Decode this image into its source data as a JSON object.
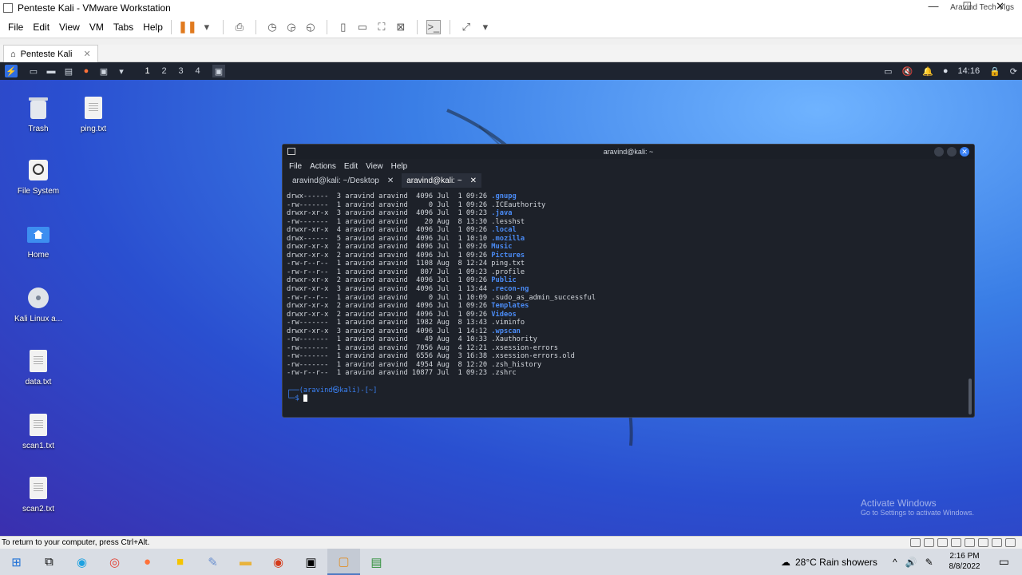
{
  "vmware": {
    "title": "Penteste Kali - VMware Workstation",
    "watermark": "Aravind Tech Vlgs",
    "menu": [
      "File",
      "Edit",
      "View",
      "VM",
      "Tabs",
      "Help"
    ],
    "tab": "Penteste Kali",
    "status": "To return to your computer, press Ctrl+Alt."
  },
  "guest_bar": {
    "workspaces": [
      "1",
      "2",
      "3",
      "4"
    ],
    "time": "14:16"
  },
  "desktop": {
    "icons": [
      {
        "label": "Trash",
        "icon": "trash-icon"
      },
      {
        "label": "ping.txt",
        "icon": "text-file-icon"
      },
      {
        "label": "File System",
        "icon": "drive-icon"
      },
      {
        "label": "Home",
        "icon": "home-folder-icon"
      },
      {
        "label": "Kali Linux a...",
        "icon": "disc-icon"
      },
      {
        "label": "data.txt",
        "icon": "text-file-icon"
      },
      {
        "label": "scan1.txt",
        "icon": "text-file-icon"
      },
      {
        "label": "scan2.txt",
        "icon": "text-file-icon"
      }
    ],
    "activate_line1": "Activate Windows",
    "activate_line2": "Go to Settings to activate Windows."
  },
  "terminal": {
    "title": "aravind@kali: ~",
    "menu": [
      "File",
      "Actions",
      "Edit",
      "View",
      "Help"
    ],
    "tabs": [
      "aravind@kali: ~/Desktop",
      "aravind@kali: ~"
    ],
    "listing": [
      {
        "perm": "drwx------",
        "links": "3",
        "user": "aravind",
        "group": "aravind",
        "size": "4096",
        "month": "Jul",
        "day": "1",
        "time": "09:26",
        "name": ".gnupg",
        "dir": true
      },
      {
        "perm": "-rw-------",
        "links": "1",
        "user": "aravind",
        "group": "aravind",
        "size": "0",
        "month": "Jul",
        "day": "1",
        "time": "09:26",
        "name": ".ICEauthority",
        "dir": false
      },
      {
        "perm": "drwxr-xr-x",
        "links": "3",
        "user": "aravind",
        "group": "aravind",
        "size": "4096",
        "month": "Jul",
        "day": "1",
        "time": "09:23",
        "name": ".java",
        "dir": true
      },
      {
        "perm": "-rw-------",
        "links": "1",
        "user": "aravind",
        "group": "aravind",
        "size": "20",
        "month": "Aug",
        "day": "8",
        "time": "13:30",
        "name": ".lesshst",
        "dir": false
      },
      {
        "perm": "drwxr-xr-x",
        "links": "4",
        "user": "aravind",
        "group": "aravind",
        "size": "4096",
        "month": "Jul",
        "day": "1",
        "time": "09:26",
        "name": ".local",
        "dir": true
      },
      {
        "perm": "drwx------",
        "links": "5",
        "user": "aravind",
        "group": "aravind",
        "size": "4096",
        "month": "Jul",
        "day": "1",
        "time": "10:10",
        "name": ".mozilla",
        "dir": true
      },
      {
        "perm": "drwxr-xr-x",
        "links": "2",
        "user": "aravind",
        "group": "aravind",
        "size": "4096",
        "month": "Jul",
        "day": "1",
        "time": "09:26",
        "name": "Music",
        "dir": true
      },
      {
        "perm": "drwxr-xr-x",
        "links": "2",
        "user": "aravind",
        "group": "aravind",
        "size": "4096",
        "month": "Jul",
        "day": "1",
        "time": "09:26",
        "name": "Pictures",
        "dir": true
      },
      {
        "perm": "-rw-r--r--",
        "links": "1",
        "user": "aravind",
        "group": "aravind",
        "size": "1108",
        "month": "Aug",
        "day": "8",
        "time": "12:24",
        "name": "ping.txt",
        "dir": false
      },
      {
        "perm": "-rw-r--r--",
        "links": "1",
        "user": "aravind",
        "group": "aravind",
        "size": "807",
        "month": "Jul",
        "day": "1",
        "time": "09:23",
        "name": ".profile",
        "dir": false
      },
      {
        "perm": "drwxr-xr-x",
        "links": "2",
        "user": "aravind",
        "group": "aravind",
        "size": "4096",
        "month": "Jul",
        "day": "1",
        "time": "09:26",
        "name": "Public",
        "dir": true
      },
      {
        "perm": "drwxr-xr-x",
        "links": "3",
        "user": "aravind",
        "group": "aravind",
        "size": "4096",
        "month": "Jul",
        "day": "1",
        "time": "13:44",
        "name": ".recon-ng",
        "dir": true
      },
      {
        "perm": "-rw-r--r--",
        "links": "1",
        "user": "aravind",
        "group": "aravind",
        "size": "0",
        "month": "Jul",
        "day": "1",
        "time": "10:09",
        "name": ".sudo_as_admin_successful",
        "dir": false
      },
      {
        "perm": "drwxr-xr-x",
        "links": "2",
        "user": "aravind",
        "group": "aravind",
        "size": "4096",
        "month": "Jul",
        "day": "1",
        "time": "09:26",
        "name": "Templates",
        "dir": true
      },
      {
        "perm": "drwxr-xr-x",
        "links": "2",
        "user": "aravind",
        "group": "aravind",
        "size": "4096",
        "month": "Jul",
        "day": "1",
        "time": "09:26",
        "name": "Videos",
        "dir": true
      },
      {
        "perm": "-rw-------",
        "links": "1",
        "user": "aravind",
        "group": "aravind",
        "size": "1982",
        "month": "Aug",
        "day": "8",
        "time": "13:43",
        "name": ".viminfo",
        "dir": false
      },
      {
        "perm": "drwxr-xr-x",
        "links": "3",
        "user": "aravind",
        "group": "aravind",
        "size": "4096",
        "month": "Jul",
        "day": "1",
        "time": "14:12",
        "name": ".wpscan",
        "dir": true
      },
      {
        "perm": "-rw-------",
        "links": "1",
        "user": "aravind",
        "group": "aravind",
        "size": "49",
        "month": "Aug",
        "day": "4",
        "time": "10:33",
        "name": ".Xauthority",
        "dir": false
      },
      {
        "perm": "-rw-------",
        "links": "1",
        "user": "aravind",
        "group": "aravind",
        "size": "7056",
        "month": "Aug",
        "day": "4",
        "time": "12:21",
        "name": ".xsession-errors",
        "dir": false
      },
      {
        "perm": "-rw-------",
        "links": "1",
        "user": "aravind",
        "group": "aravind",
        "size": "6556",
        "month": "Aug",
        "day": "3",
        "time": "16:38",
        "name": ".xsession-errors.old",
        "dir": false
      },
      {
        "perm": "-rw-------",
        "links": "1",
        "user": "aravind",
        "group": "aravind",
        "size": "4954",
        "month": "Aug",
        "day": "8",
        "time": "12:20",
        "name": ".zsh_history",
        "dir": false
      },
      {
        "perm": "-rw-r--r--",
        "links": "1",
        "user": "aravind",
        "group": "aravind",
        "size": "10877",
        "month": "Jul",
        "day": "1",
        "time": "09:23",
        "name": ".zshrc",
        "dir": false
      }
    ],
    "prompt_line1": "┌──(aravind㉿kali)-[~]",
    "prompt_line2": "└─$ "
  },
  "taskbar": {
    "weather": "28°C  Rain showers",
    "time": "2:16 PM",
    "date": "8/8/2022"
  },
  "colors": {
    "dir_blue": "#4a8bf5",
    "terminal_bg": "#1d2129",
    "pause_orange": "#e07a1f"
  }
}
